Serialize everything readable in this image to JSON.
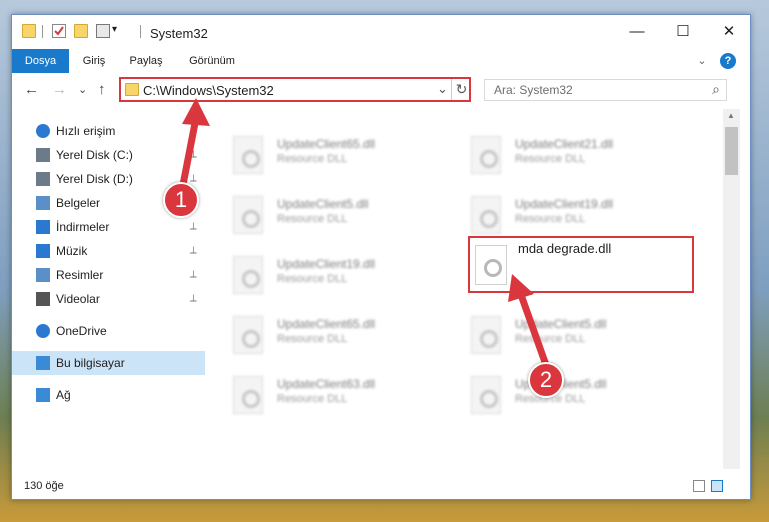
{
  "window": {
    "title": "System32",
    "minimize": "—",
    "maximize": "☐",
    "close": "✕"
  },
  "ribbon": {
    "tabs": [
      "Dosya",
      "Giriş",
      "Paylaş",
      "Görünüm"
    ],
    "collapse": "⌄",
    "help": "?"
  },
  "nav": {
    "back": "←",
    "forward": "→",
    "recent": "⌄",
    "up": "↑"
  },
  "address": {
    "path": "C:\\Windows\\System32",
    "dropdown": "⌄",
    "refresh": "↻"
  },
  "search": {
    "placeholder": "Ara: System32",
    "icon": "⌕"
  },
  "sidebar": {
    "items": [
      {
        "label": "Hızlı erişim",
        "icon": "star-icon",
        "pinned": false
      },
      {
        "label": "Yerel Disk (C:)",
        "icon": "drive-icon",
        "pinned": true
      },
      {
        "label": "Yerel Disk (D:)",
        "icon": "drive-icon",
        "pinned": true
      },
      {
        "label": "Belgeler",
        "icon": "documents-icon",
        "pinned": true
      },
      {
        "label": "İndirmeler",
        "icon": "downloads-icon",
        "pinned": true
      },
      {
        "label": "Müzik",
        "icon": "music-icon",
        "pinned": true
      },
      {
        "label": "Resimler",
        "icon": "pictures-icon",
        "pinned": true
      },
      {
        "label": "Videolar",
        "icon": "videos-icon",
        "pinned": true
      },
      {
        "label": "OneDrive",
        "icon": "cloud-icon",
        "pinned": false
      },
      {
        "label": "Bu bilgisayar",
        "icon": "computer-icon",
        "pinned": false
      },
      {
        "label": "Ağ",
        "icon": "network-icon",
        "pinned": false
      }
    ],
    "pin_glyph": "📌"
  },
  "files": [
    {
      "name": "UpdateClient65.dll",
      "type": "Resource DLL"
    },
    {
      "name": "UpdateClient21.dll",
      "type": "Resource DLL"
    },
    {
      "name": "UpdateClient5.dll",
      "type": "Resource DLL"
    },
    {
      "name": "UpdateClient19.dll",
      "type": "Resource DLL"
    },
    {
      "name": "UpdateClient19.dll",
      "type": "Resource DLL"
    },
    {
      "name": "UpdateClient65.dll",
      "type": "Resource DLL"
    },
    {
      "name": "UpdateClient5.dll",
      "type": "Resource DLL"
    },
    {
      "name": "UpdateClient63.dll",
      "type": "Resource DLL"
    },
    {
      "name": "UpdateClient5.dll",
      "type": "Resource DLL"
    }
  ],
  "selected_file": {
    "name": "mda degrade.dll"
  },
  "callouts": [
    "1",
    "2"
  ],
  "status": {
    "count": "130 öğe"
  },
  "colors": {
    "accent": "#1979ca",
    "highlight": "#d9363e",
    "selection": "#cce4f7"
  }
}
